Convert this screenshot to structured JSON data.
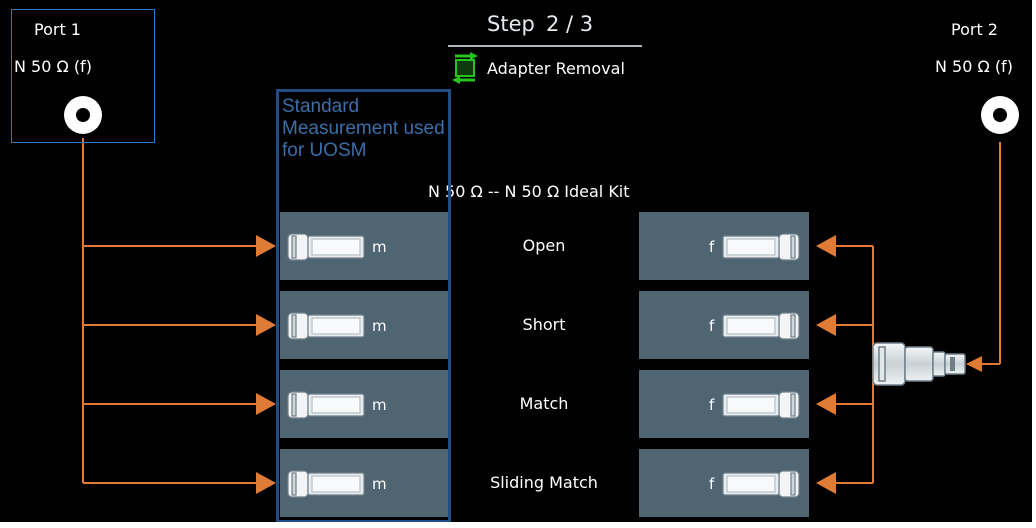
{
  "header": {
    "step_label": "Step",
    "step_value": "2 / 3",
    "action_label": "Adapter Removal"
  },
  "port1": {
    "name": "Port 1",
    "connector": "N 50 Ω (f)"
  },
  "port2": {
    "name": "Port 2",
    "connector": "N 50 Ω (f)"
  },
  "standard_note": "Standard Measurement used for UOSM",
  "kit_label": "N 50 Ω  -- N 50 Ω Ideal Kit",
  "standards": [
    {
      "name": "Open",
      "left_gender": "m",
      "right_gender": "f"
    },
    {
      "name": "Short",
      "left_gender": "m",
      "right_gender": "f"
    },
    {
      "name": "Match",
      "left_gender": "m",
      "right_gender": "f"
    },
    {
      "name": "Sliding Match",
      "left_gender": "m",
      "right_gender": "f"
    }
  ],
  "colors": {
    "background": "#000000",
    "cable": "#e07b35",
    "panel": "#4f6572",
    "highlight_frame": "#1f4e86",
    "adapter_icon": "#27c41f"
  },
  "icons": {
    "adapter_removal": "adapter-removal-icon",
    "port_jack": "coax-port-icon",
    "connector": "coax-connector-icon"
  }
}
